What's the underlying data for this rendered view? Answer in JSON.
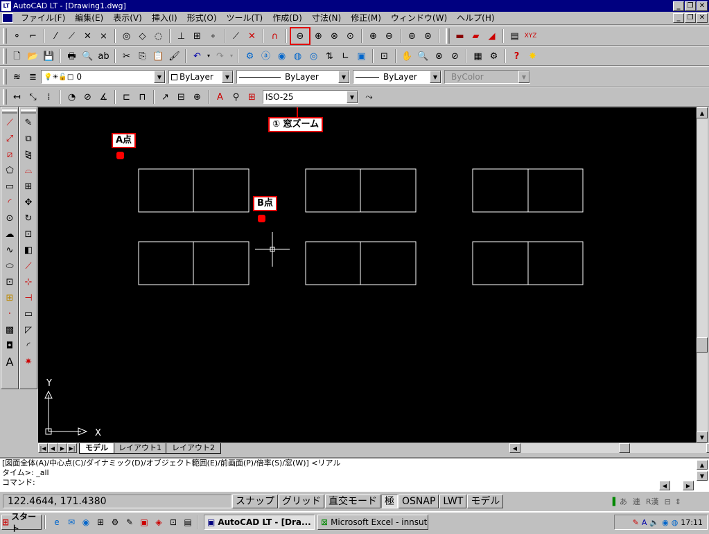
{
  "window": {
    "title": "AutoCAD LT - [Drawing1.dwg]",
    "app_icon": "LT"
  },
  "menu": [
    "ファイル(F)",
    "編集(E)",
    "表示(V)",
    "挿入(I)",
    "形式(O)",
    "ツール(T)",
    "作成(D)",
    "寸法(N)",
    "修正(M)",
    "ウィンドウ(W)",
    "ヘルプ(H)"
  ],
  "layer_bar": {
    "layer_value": "0",
    "color": "ByLayer",
    "linetype": "ByLayer",
    "lineweight": "ByLayer",
    "plotstyle": "ByColor"
  },
  "dim_bar": {
    "dimstyle": "ISO-25"
  },
  "callouts": {
    "zoom_window": "① 窓ズーム",
    "point_a": "A点",
    "point_b": "B点"
  },
  "ucs": {
    "x_label": "X",
    "y_label": "Y"
  },
  "layout_tabs": [
    "モデル",
    "レイアウト1",
    "レイアウト2"
  ],
  "command_lines": [
    "[図面全体(A)/中心点(C)/ダイナミック(D)/オブジェクト範囲(E)/前画面(P)/倍率(S)/窓(W)] <リアル",
    "タイム>:  _all",
    "コマンド:"
  ],
  "status": {
    "coords": "122.4644, 171.4380",
    "toggles": [
      "スナップ",
      "グリッド",
      "直交モード",
      "極",
      "OSNAP",
      "LWT",
      "モデル"
    ]
  },
  "ime": [
    "あ",
    "連",
    "R漢"
  ],
  "taskbar": {
    "start": "スタート",
    "tasks": [
      "AutoCAD LT - [Dra...",
      "Microsoft Excel - innsut..."
    ],
    "clock": "17:11"
  },
  "colors": {
    "titlebar": "#000080",
    "canvas": "#000000",
    "callout_border": "#e00000",
    "marker": "#ff0000"
  }
}
